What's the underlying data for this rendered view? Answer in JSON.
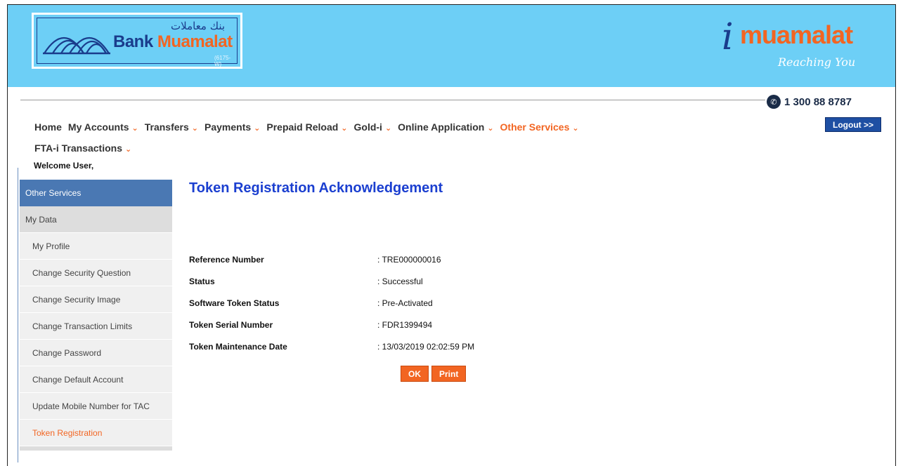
{
  "brand": {
    "name_prefix": "Bank ",
    "name_suffix": "Muamalat",
    "arabic": "بنك معاملات",
    "reg_no": "(6175-W)",
    "portal_i": "i",
    "portal_name": "muamalat",
    "tagline": "Reaching You"
  },
  "contact": {
    "phone": "1 300 88 8787",
    "phone_icon": "phone-icon"
  },
  "nav": {
    "items": [
      {
        "label": "Home",
        "dropdown": false
      },
      {
        "label": "My Accounts",
        "dropdown": true
      },
      {
        "label": "Transfers",
        "dropdown": true
      },
      {
        "label": "Payments",
        "dropdown": true
      },
      {
        "label": "Prepaid Reload",
        "dropdown": true
      },
      {
        "label": "Gold-i",
        "dropdown": true
      },
      {
        "label": "Online Application",
        "dropdown": true
      },
      {
        "label": "Other Services",
        "dropdown": true,
        "active": true
      },
      {
        "label": "FTA-i Transactions",
        "dropdown": true
      }
    ],
    "chevron": "⌄",
    "logout_label": "Logout >>"
  },
  "welcome": "Welcome User,",
  "sidebar": {
    "header": "Other Services",
    "section": "My Data",
    "items": [
      {
        "label": "My Profile"
      },
      {
        "label": "Change Security Question"
      },
      {
        "label": "Change Security Image"
      },
      {
        "label": "Change Transaction Limits"
      },
      {
        "label": "Change Password"
      },
      {
        "label": "Change Default Account"
      },
      {
        "label": "Update Mobile Number for TAC"
      },
      {
        "label": "Token Registration",
        "active": true
      }
    ]
  },
  "main": {
    "title": "Token Registration Acknowledgement",
    "rows": [
      {
        "label": "Reference Number",
        "value": ": TRE000000016"
      },
      {
        "label": "Status",
        "value": ": Successful"
      },
      {
        "label": "Software Token Status",
        "value": ": Pre-Activated"
      },
      {
        "label": "Token Serial Number",
        "value": ": FDR1399494"
      },
      {
        "label": "Token Maintenance Date",
        "value": ": 13/03/2019 02:02:59 PM"
      }
    ],
    "ok_label": "OK",
    "print_label": "Print"
  },
  "colors": {
    "header_bg": "#6dcff6",
    "brand_blue": "#1a3c8c",
    "accent_orange": "#f26522",
    "sidebar_head": "#4a78b3",
    "title_blue": "#1b3fd0"
  }
}
